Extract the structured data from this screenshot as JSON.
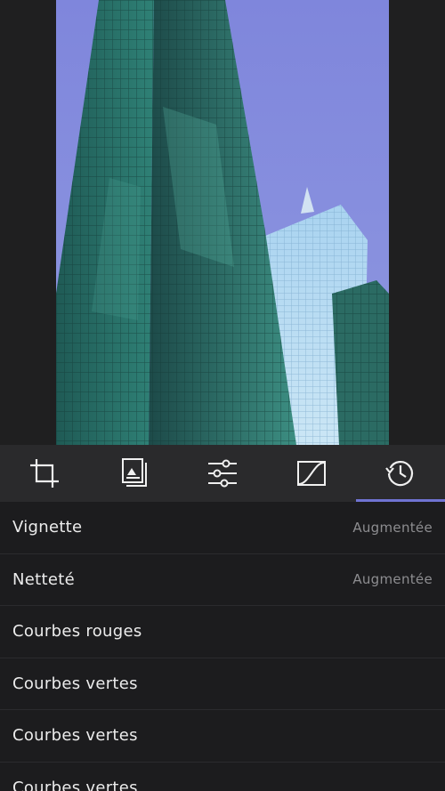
{
  "toolbar": {
    "tools": [
      {
        "icon": "crop-icon",
        "active": false
      },
      {
        "icon": "filters-icon",
        "active": false
      },
      {
        "icon": "adjust-sliders-icon",
        "active": false
      },
      {
        "icon": "curves-icon",
        "active": false
      },
      {
        "icon": "history-icon",
        "active": true
      }
    ],
    "accent_color": "#6f73d2"
  },
  "history": {
    "items": [
      {
        "label": "Vignette",
        "value": "Augmentée"
      },
      {
        "label": "Netteté",
        "value": "Augmentée"
      },
      {
        "label": "Courbes rouges",
        "value": ""
      },
      {
        "label": "Courbes vertes",
        "value": ""
      },
      {
        "label": "Courbes vertes",
        "value": ""
      },
      {
        "label": "Courbes vertes",
        "value": ""
      }
    ]
  }
}
